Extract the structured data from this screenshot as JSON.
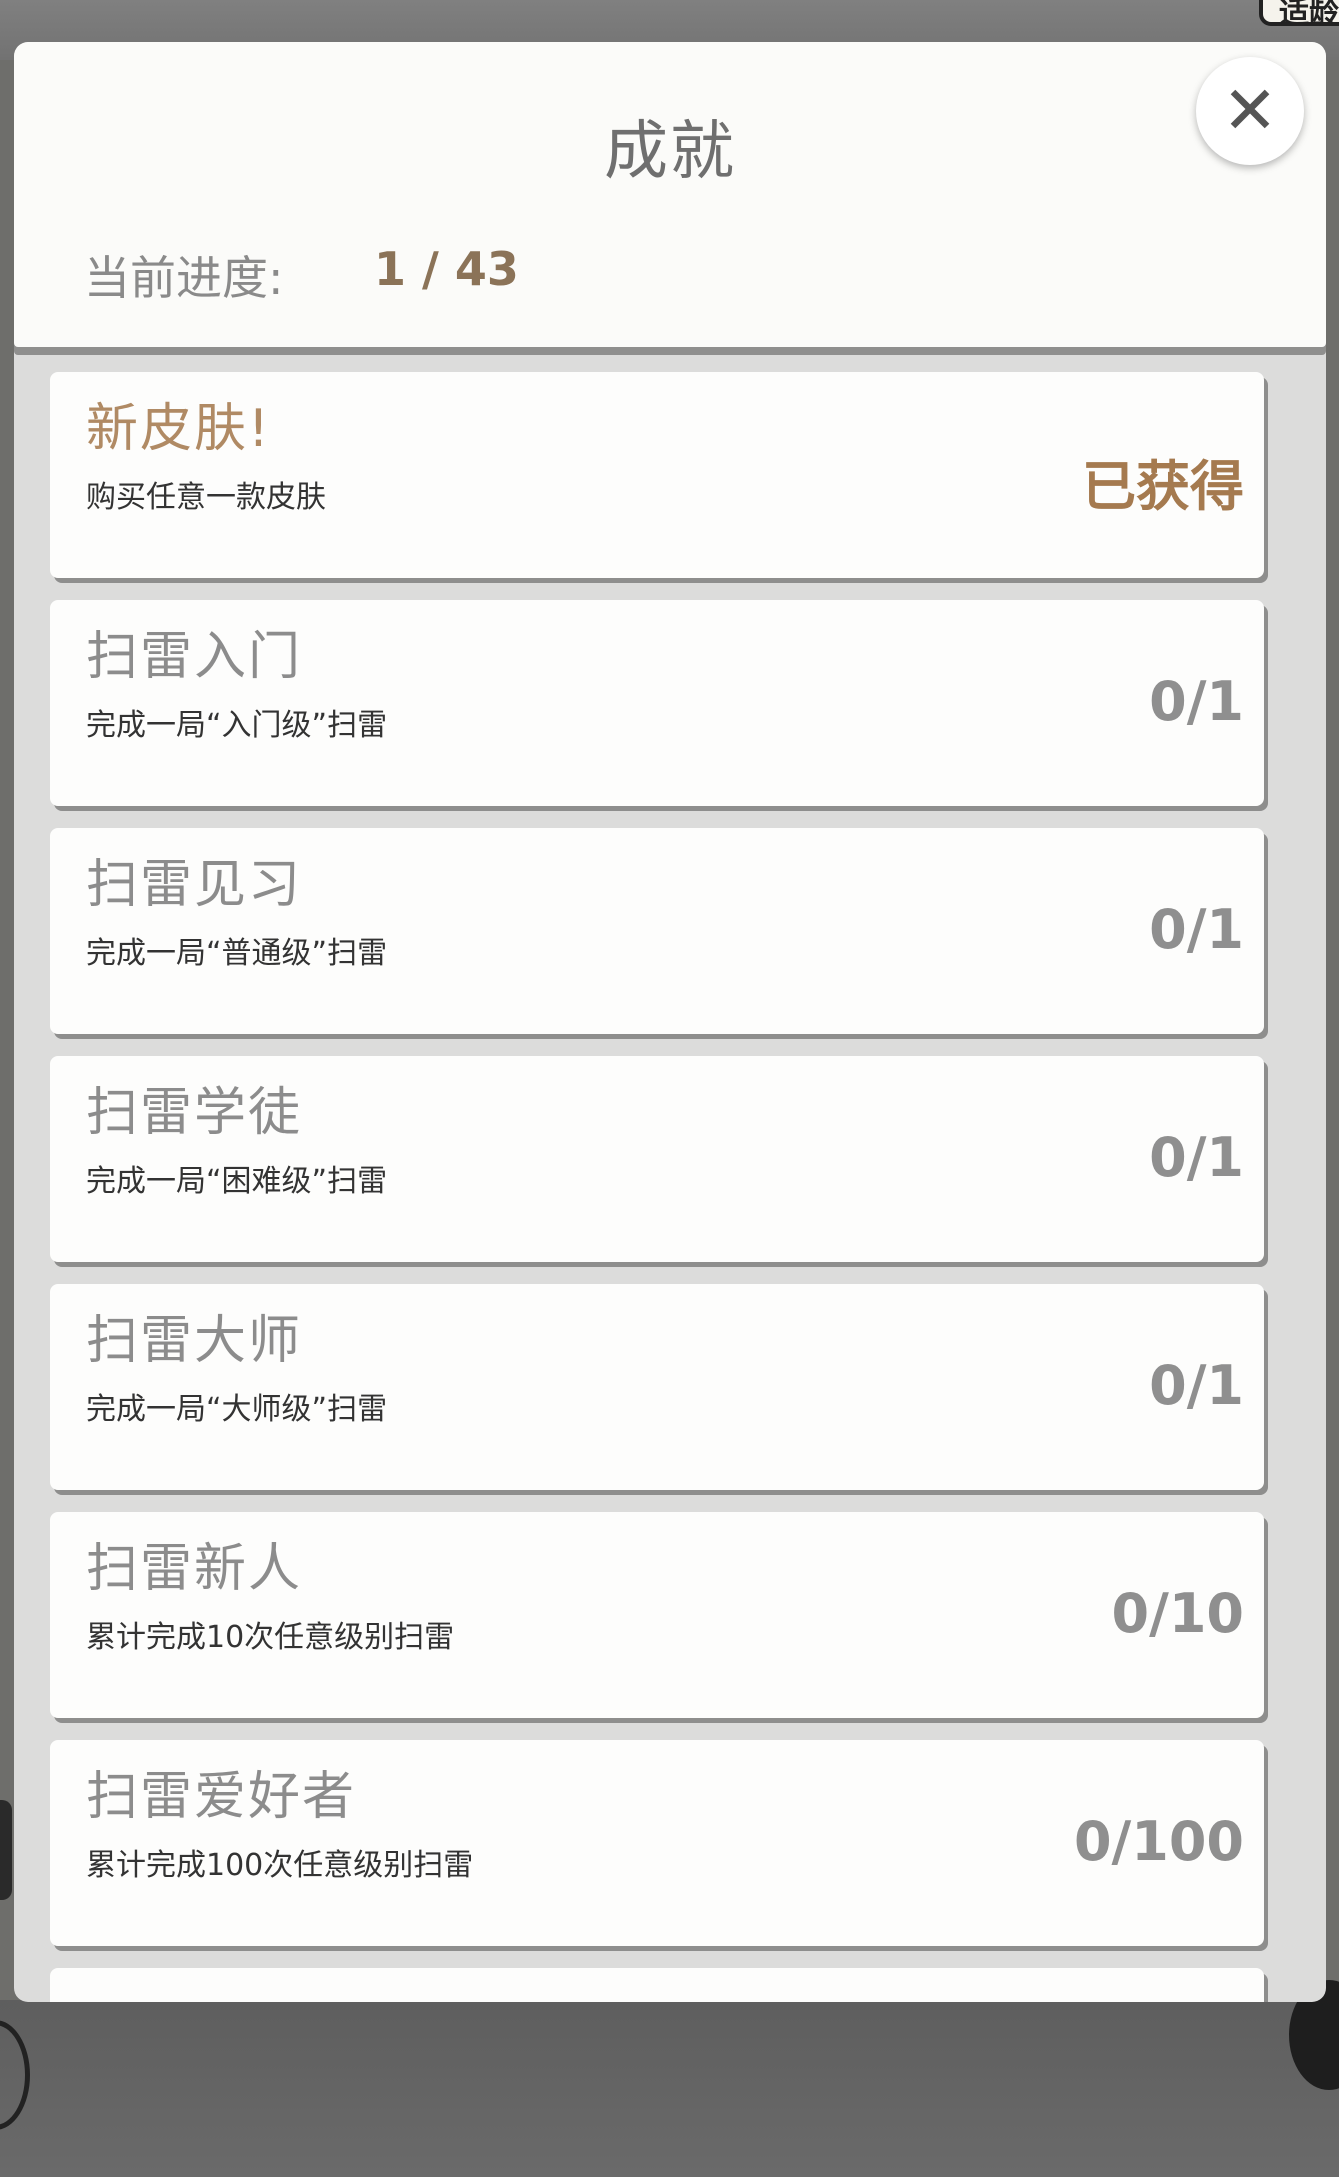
{
  "corner_badge": "适龄提",
  "dialog": {
    "title": "成就",
    "close_symbol": "✕",
    "progress_label": "当前进度:",
    "progress_value": "1 / 43"
  },
  "achievements": [
    {
      "title": "新皮肤!",
      "description": "购买任意一款皮肤",
      "status": "已获得",
      "earned": true
    },
    {
      "title": "扫雷入门",
      "description": "完成一局“入门级”扫雷",
      "status": "0/1",
      "earned": false
    },
    {
      "title": "扫雷见习",
      "description": "完成一局“普通级”扫雷",
      "status": "0/1",
      "earned": false
    },
    {
      "title": "扫雷学徒",
      "description": "完成一局“困难级”扫雷",
      "status": "0/1",
      "earned": false
    },
    {
      "title": "扫雷大师",
      "description": "完成一局“大师级”扫雷",
      "status": "0/1",
      "earned": false
    },
    {
      "title": "扫雷新人",
      "description": "累计完成10次任意级别扫雷",
      "status": "0/10",
      "earned": false
    },
    {
      "title": "扫雷爱好者",
      "description": "累计完成100次任意级别扫雷",
      "status": "0/100",
      "earned": false
    }
  ],
  "colors": {
    "earned_accent": "#a57a4f",
    "pending_text": "#8f8f8f",
    "card_bg": "#fdfdfc"
  }
}
